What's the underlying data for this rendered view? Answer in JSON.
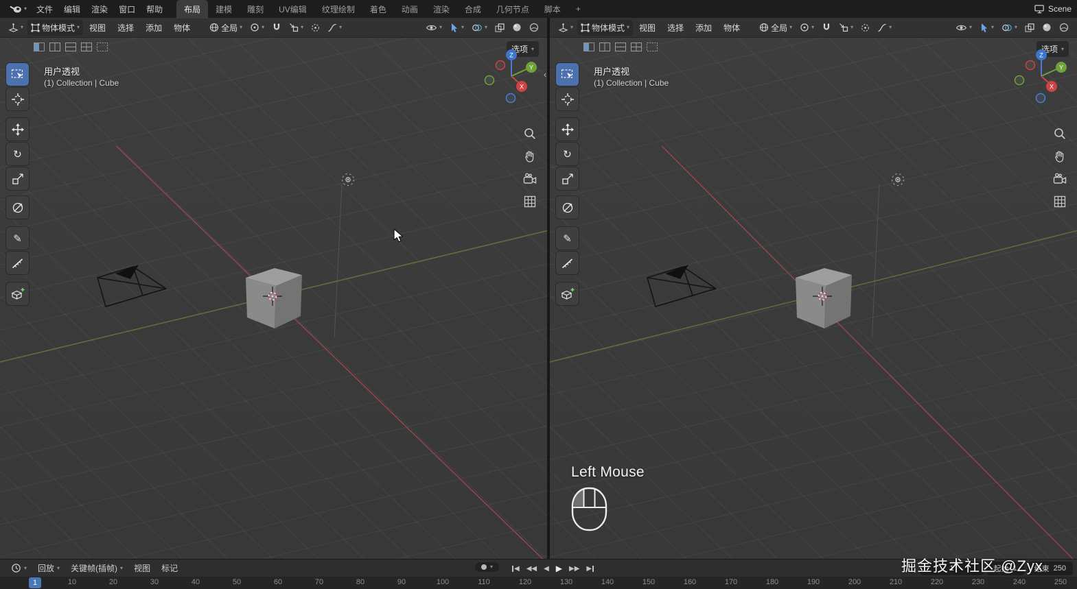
{
  "topbar": {
    "menus": [
      "文件",
      "编辑",
      "渲染",
      "窗口",
      "帮助"
    ],
    "tabs": [
      "布局",
      "建模",
      "雕刻",
      "UV编辑",
      "纹理绘制",
      "着色",
      "动画",
      "渲染",
      "合成",
      "几何节点",
      "脚本",
      "+"
    ],
    "active_tab": "布局",
    "scene_label": "Scene"
  },
  "viewport": {
    "header": {
      "mode_label": "物体模式",
      "menus": [
        "视图",
        "选择",
        "添加",
        "物体"
      ],
      "orientation_label": "全局"
    },
    "overlay": {
      "options_label": "选项",
      "view_name": "用户透视",
      "breadcrumb": "(1) Collection | Cube"
    },
    "axis_gizmo": {
      "x": "X",
      "y": "Y",
      "z": "Z"
    }
  },
  "screencast": {
    "label": "Left Mouse"
  },
  "timeline": {
    "menus": [
      "回放",
      "关键帧(插帧)",
      "视图",
      "标记"
    ],
    "playhead": "1",
    "current_frame": "1",
    "start_label": "起始",
    "start_value": "1",
    "end_label": "结束",
    "end_value": "250",
    "ruler": [
      "10",
      "20",
      "30",
      "40",
      "50",
      "60",
      "70",
      "80",
      "90",
      "100",
      "110",
      "120",
      "130",
      "140",
      "150",
      "160",
      "170",
      "180",
      "190",
      "200",
      "210",
      "220",
      "230",
      "240",
      "250"
    ]
  },
  "watermark": {
    "text": "掘金技术社区 @Zyx"
  },
  "icons": {
    "toolbar": [
      "box-select-tool",
      "cursor-tool",
      "move-tool",
      "rotate-tool",
      "scale-tool",
      "transform-tool",
      "annotate-tool",
      "measure-tool",
      "add-cube-tool"
    ],
    "nav_side": [
      "zoom-icon",
      "pan-hand-icon",
      "camera-view-icon",
      "orthographic-grid-icon"
    ],
    "header_right": [
      "eye-icon",
      "gizmo-arrow-icon",
      "overlays-icon",
      "xray-icon",
      "shading-sphere-icon"
    ]
  },
  "colors": {
    "accent_active_tool": "#4b71ae",
    "axis_x": "#a84653",
    "axis_y": "#5f7d37",
    "gizmo_x": "#cd4444",
    "gizmo_y": "#6fa33a",
    "gizmo_z": "#3e74c9",
    "playhead": "#4a77b5"
  }
}
